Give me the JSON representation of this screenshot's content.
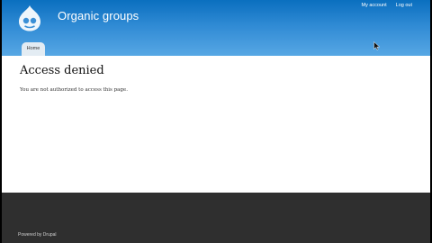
{
  "header": {
    "site_name": "Organic groups",
    "logo": "drupal-drop-logo",
    "secondary_menu": [
      "My account",
      "Log out"
    ]
  },
  "nav": {
    "tabs": [
      {
        "label": "Home",
        "active": true
      }
    ]
  },
  "main": {
    "title": "Access denied",
    "message": "You are not authorized to access this page."
  },
  "footer": {
    "powered_by": "Powered by Drupal"
  },
  "colors": {
    "header_top": "#0a6fbf",
    "header_bottom": "#57a7e4",
    "footer": "#2f2f2f",
    "content": "#ffffff"
  }
}
